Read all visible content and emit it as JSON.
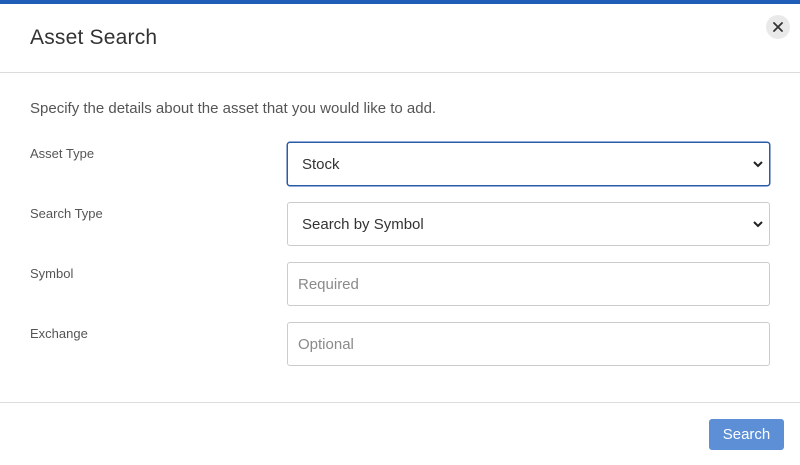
{
  "dialog": {
    "title": "Asset Search",
    "close_icon": "close-icon",
    "intro": "Specify the details about the asset that you would like to add."
  },
  "fields": {
    "asset_type": {
      "label": "Asset Type",
      "value": "Stock"
    },
    "search_type": {
      "label": "Search Type",
      "value": "Search by Symbol"
    },
    "symbol": {
      "label": "Symbol",
      "placeholder": "Required"
    },
    "exchange": {
      "label": "Exchange",
      "placeholder": "Optional"
    }
  },
  "footer": {
    "search_label": "Search"
  },
  "colors": {
    "accent_bar": "#1f5fb8",
    "focus_border": "#2a5aa8",
    "button_bg": "#5c8fd6"
  }
}
